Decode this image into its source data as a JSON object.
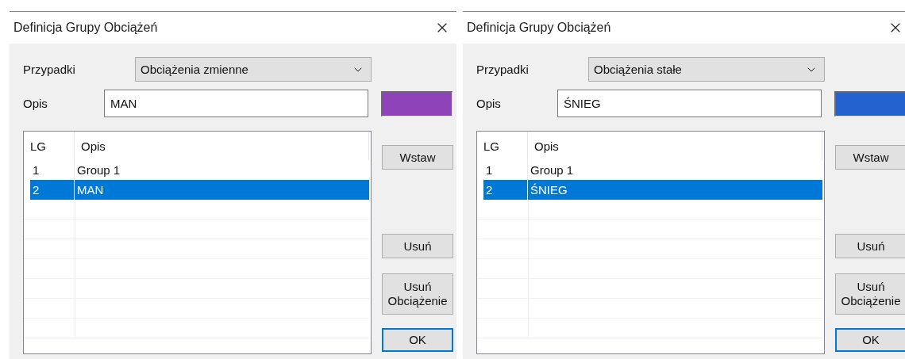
{
  "dialogs": [
    {
      "title": "Definicja Grupy Obciążeń",
      "case_label": "Przypadki",
      "case_value": "Obciążenia zmienne",
      "description_label": "Opis",
      "description_value": "MAN",
      "color": "#8e44b8",
      "table": {
        "columns": [
          "LG",
          "Opis"
        ],
        "rows": [
          {
            "lg": "1",
            "opis": "Group 1",
            "selected": false
          },
          {
            "lg": "2",
            "opis": "MAN",
            "selected": true
          }
        ]
      },
      "buttons": [
        {
          "label": "Wstaw",
          "default": false
        },
        {
          "label": "Usuń",
          "default": false
        },
        {
          "label": "Usuń\nObciążenie",
          "default": false
        },
        {
          "label": "OK",
          "default": true
        }
      ]
    },
    {
      "title": "Definicja Grupy Obciążeń",
      "case_label": "Przypadki",
      "case_value": "Obciążenia stałe",
      "description_label": "Opis",
      "description_value": "ŚNIEG",
      "color": "#2463cf",
      "table": {
        "columns": [
          "LG",
          "Opis"
        ],
        "rows": [
          {
            "lg": "1",
            "opis": "Group 1",
            "selected": false
          },
          {
            "lg": "2",
            "opis": "ŚNIEG",
            "selected": true
          }
        ]
      },
      "buttons": [
        {
          "label": "Wstaw",
          "default": false
        },
        {
          "label": "Usuń",
          "default": false
        },
        {
          "label": "Usuń\nObciążenie",
          "default": false
        },
        {
          "label": "OK",
          "default": true
        }
      ]
    }
  ]
}
